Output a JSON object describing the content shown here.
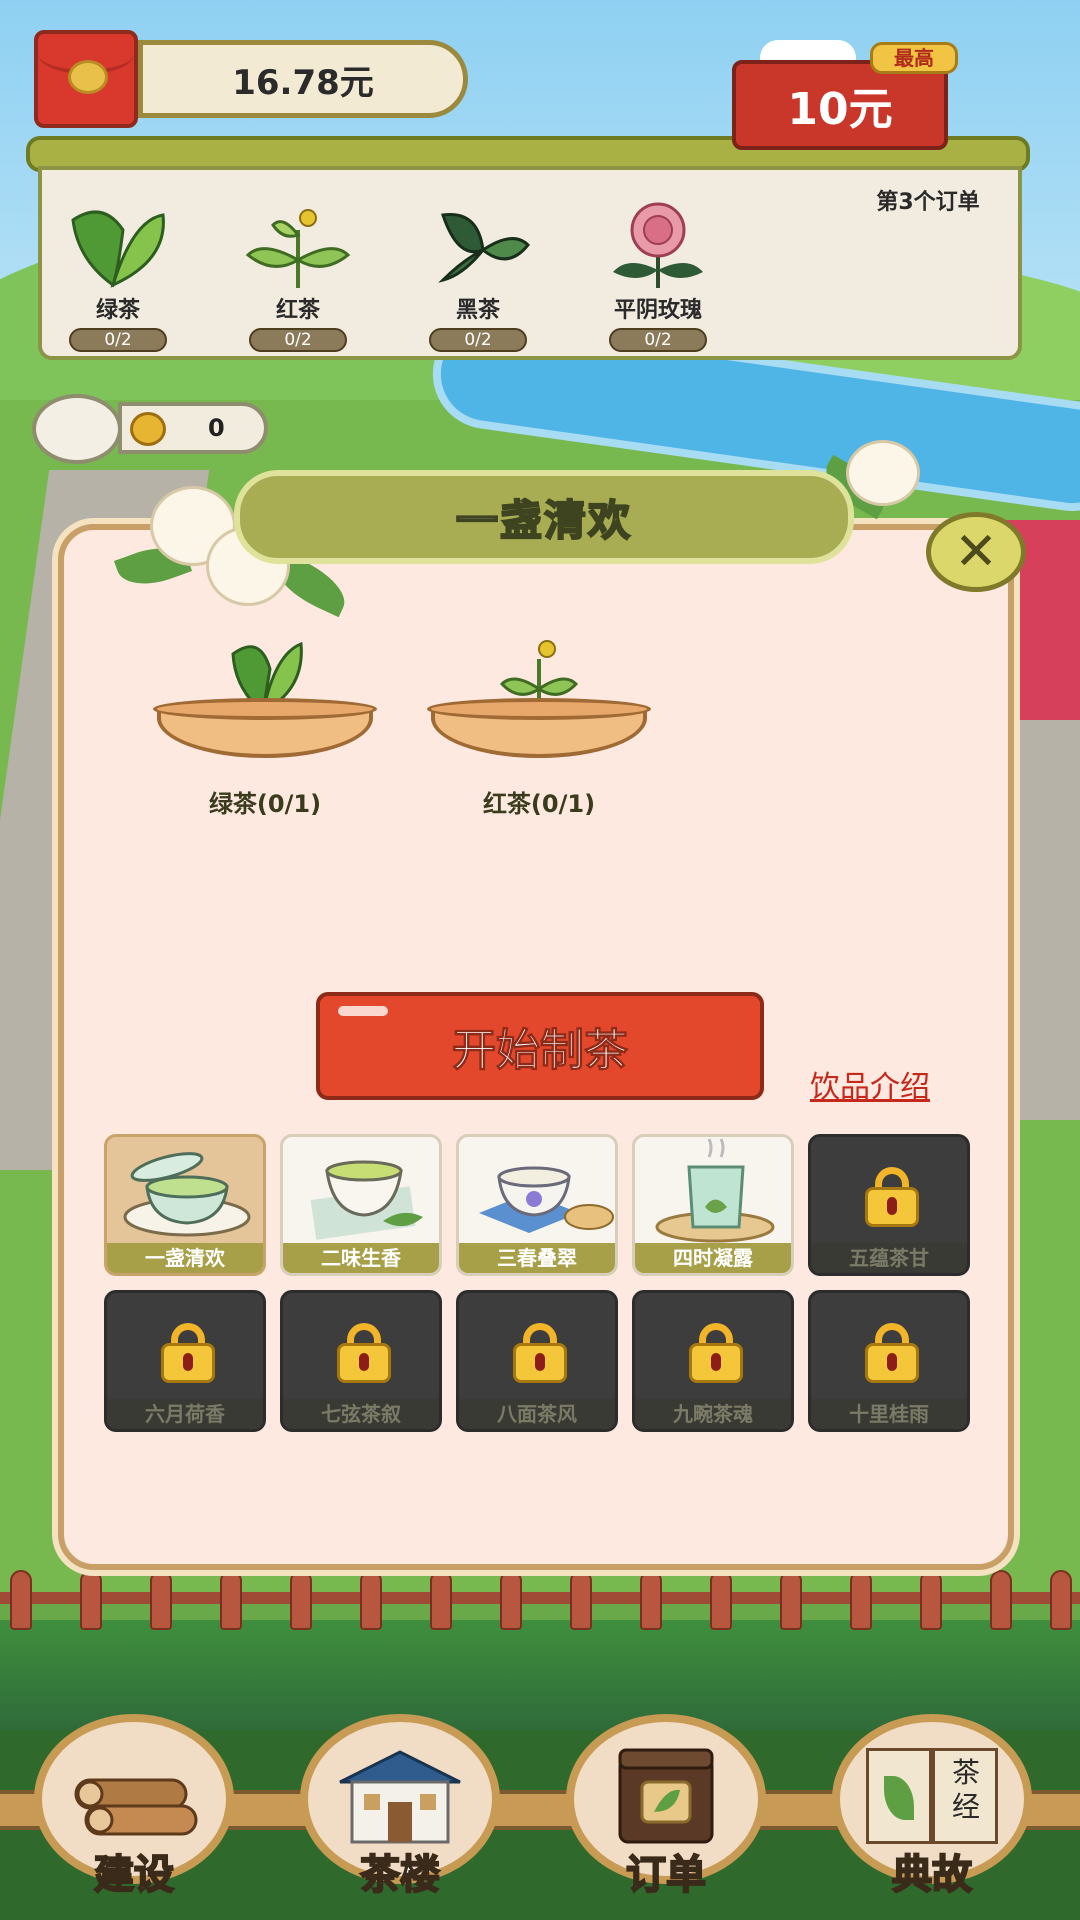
{
  "balance": "16.78元",
  "order": {
    "title": "第3个订单",
    "reward": "10元",
    "tag": "最高",
    "ingredients": [
      {
        "name": "绿茶",
        "count": "0/2"
      },
      {
        "name": "红茶",
        "count": "0/2"
      },
      {
        "name": "黑茶",
        "count": "0/2"
      },
      {
        "name": "平阴玫瑰",
        "count": "0/2"
      }
    ]
  },
  "coins": "0",
  "modal": {
    "title": "一盏清欢",
    "close_icon": "✕",
    "baskets": [
      {
        "label": "绿茶(0/1)"
      },
      {
        "label": "红茶(0/1)"
      }
    ],
    "start_button": "开始制茶",
    "intro_link": "饮品介绍",
    "drinks": [
      {
        "name": "一盏清欢",
        "locked": false
      },
      {
        "name": "二味生香",
        "locked": false
      },
      {
        "name": "三春叠翠",
        "locked": false
      },
      {
        "name": "四时凝露",
        "locked": false
      },
      {
        "name": "五蕴茶甘",
        "locked": true
      },
      {
        "name": "六月荷香",
        "locked": true
      },
      {
        "name": "七弦茶叙",
        "locked": true
      },
      {
        "name": "八面茶风",
        "locked": true
      },
      {
        "name": "九畹茶魂",
        "locked": true
      },
      {
        "name": "十里桂雨",
        "locked": true
      }
    ]
  },
  "nav": {
    "build": "建设",
    "teahouse": "茶楼",
    "orders": "订单",
    "stories": "典故",
    "book_text_1": "茶",
    "book_text_2": "经"
  }
}
